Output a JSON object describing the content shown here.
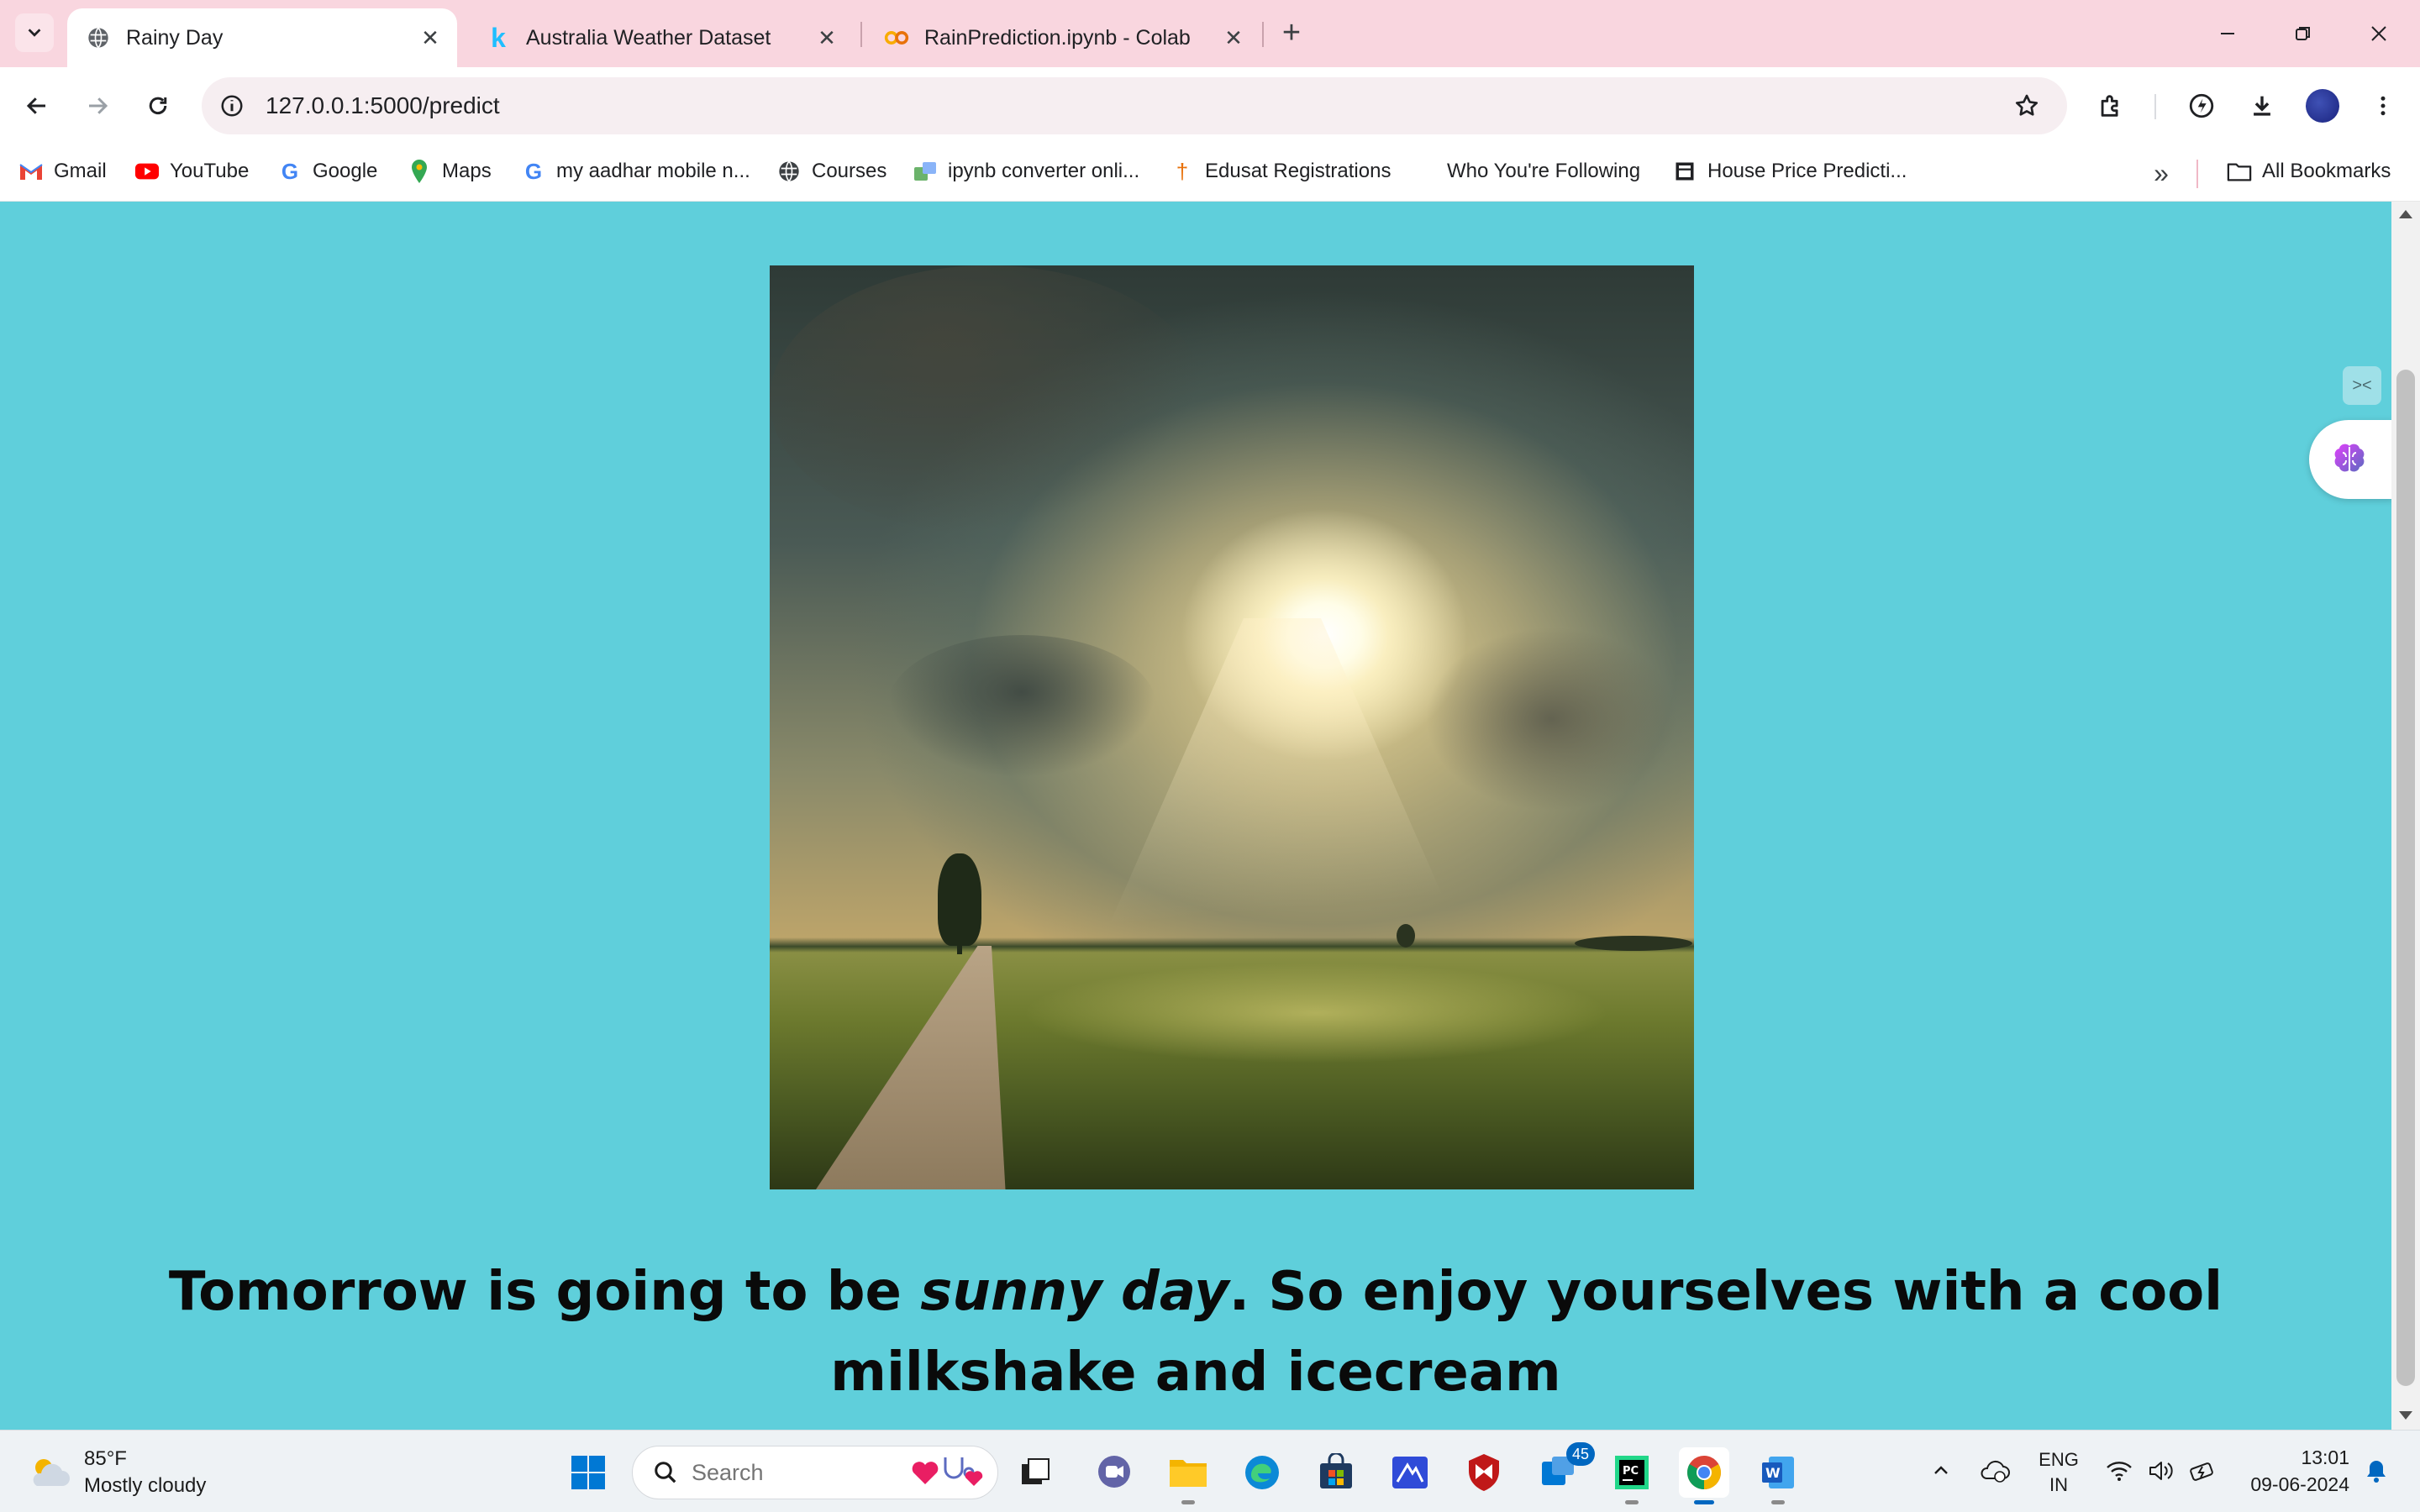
{
  "browser": {
    "tabs": [
      {
        "title": "Rainy Day",
        "icon": "globe-icon",
        "active": true
      },
      {
        "title": "Australia Weather Dataset",
        "icon": "kaggle-icon",
        "active": false
      },
      {
        "title": "RainPrediction.ipynb - Colab",
        "icon": "colab-icon",
        "active": false
      }
    ],
    "url": "127.0.0.1:5000/predict",
    "bookmarks": [
      {
        "label": "Gmail",
        "icon": "gmail-icon"
      },
      {
        "label": "YouTube",
        "icon": "youtube-icon"
      },
      {
        "label": "Google",
        "icon": "google-icon"
      },
      {
        "label": "Maps",
        "icon": "maps-icon"
      },
      {
        "label": "my aadhar mobile n...",
        "icon": "google-icon"
      },
      {
        "label": "Courses",
        "icon": "globe-icon"
      },
      {
        "label": "ipynb converter onli...",
        "icon": "converter-icon"
      },
      {
        "label": "Edusat Registrations",
        "icon": "edusat-icon"
      },
      {
        "label": "Who You're Following",
        "icon": "blank-icon"
      },
      {
        "label": "House Price Predicti...",
        "icon": "page-icon"
      }
    ],
    "all_bookmarks_label": "All Bookmarks"
  },
  "page": {
    "message_before": "Tomorrow is going to be ",
    "message_emphasis": "sunny day",
    "message_after": ". So enjoy yourselves with a cool milkshake and icecream"
  },
  "taskbar": {
    "weather_temp": "85°F",
    "weather_desc": "Mostly cloudy",
    "search_placeholder": "Search",
    "teams_badge": "45",
    "lang_line1": "ENG",
    "lang_line2": "IN",
    "time": "13:01",
    "date": "09-06-2024"
  },
  "colors": {
    "page_background": "#5fcfdb",
    "tabstrip_background": "#f9d6df",
    "text": "#0a0a0a"
  }
}
